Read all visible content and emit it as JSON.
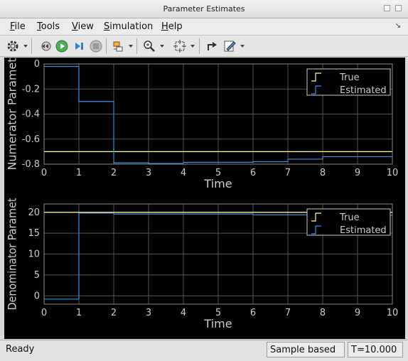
{
  "window": {
    "title": "Parameter Estimates"
  },
  "menu": {
    "items": [
      {
        "label": "File",
        "mnemonic": "F",
        "rest": "ile"
      },
      {
        "label": "Tools",
        "mnemonic": "T",
        "rest": "ools"
      },
      {
        "label": "View",
        "mnemonic": "V",
        "rest": "iew"
      },
      {
        "label": "Simulation",
        "mnemonic": "S",
        "rest": "imulation"
      },
      {
        "label": "Help",
        "mnemonic": "H",
        "rest": "elp"
      }
    ]
  },
  "toolbar": {
    "icons": [
      "gear-icon",
      "step-back-icon",
      "run-icon",
      "step-forward-icon",
      "stop-icon",
      "signal-select-icon",
      "zoom-in-icon",
      "fit-view-icon",
      "restore-icon",
      "style-icon"
    ]
  },
  "colors": {
    "true_line": "#ffff99",
    "estimated_line": "#3d8ee6",
    "axes_bg": "#000000",
    "grid": "#555555",
    "text": "#cccccc"
  },
  "status": {
    "state": "Ready",
    "mode": "Sample based",
    "time": "T=10.000"
  },
  "chart_data": [
    {
      "type": "line",
      "step": true,
      "xlabel": "Time",
      "ylabel": "Numerator Paramet",
      "xlim": [
        0,
        10
      ],
      "ylim": [
        -0.8,
        0
      ],
      "xticks": [
        0,
        1,
        2,
        3,
        4,
        5,
        6,
        7,
        8,
        9,
        10
      ],
      "yticks": [
        0,
        -0.2,
        -0.4,
        -0.6,
        -0.8
      ],
      "legend": "top-right",
      "series": [
        {
          "name": "True",
          "x": [
            0,
            10
          ],
          "y": [
            -0.7,
            -0.7
          ]
        },
        {
          "name": "Estimated",
          "x": [
            0,
            1,
            2,
            3,
            4,
            5,
            6,
            7,
            8,
            9,
            10
          ],
          "y": [
            -0.02,
            -0.3,
            -0.79,
            -0.795,
            -0.785,
            -0.785,
            -0.78,
            -0.76,
            -0.74,
            -0.74,
            -0.74
          ]
        }
      ]
    },
    {
      "type": "line",
      "step": true,
      "xlabel": "Time",
      "ylabel": "Denominator Paramet",
      "xlim": [
        0,
        10
      ],
      "ylim": [
        -2,
        22
      ],
      "xticks": [
        0,
        1,
        2,
        3,
        4,
        5,
        6,
        7,
        8,
        9,
        10
      ],
      "yticks": [
        0,
        5,
        10,
        15,
        20
      ],
      "legend": "top-right",
      "series": [
        {
          "name": "True",
          "x": [
            0,
            10
          ],
          "y": [
            20,
            20
          ]
        },
        {
          "name": "Estimated",
          "x": [
            0,
            1,
            2,
            3,
            4,
            5,
            6,
            7,
            8,
            9,
            10
          ],
          "y": [
            -0.8,
            19.8,
            19.6,
            19.6,
            19.6,
            19.6,
            19.4,
            19.4,
            19.3,
            19.3,
            19.3
          ]
        }
      ]
    }
  ]
}
